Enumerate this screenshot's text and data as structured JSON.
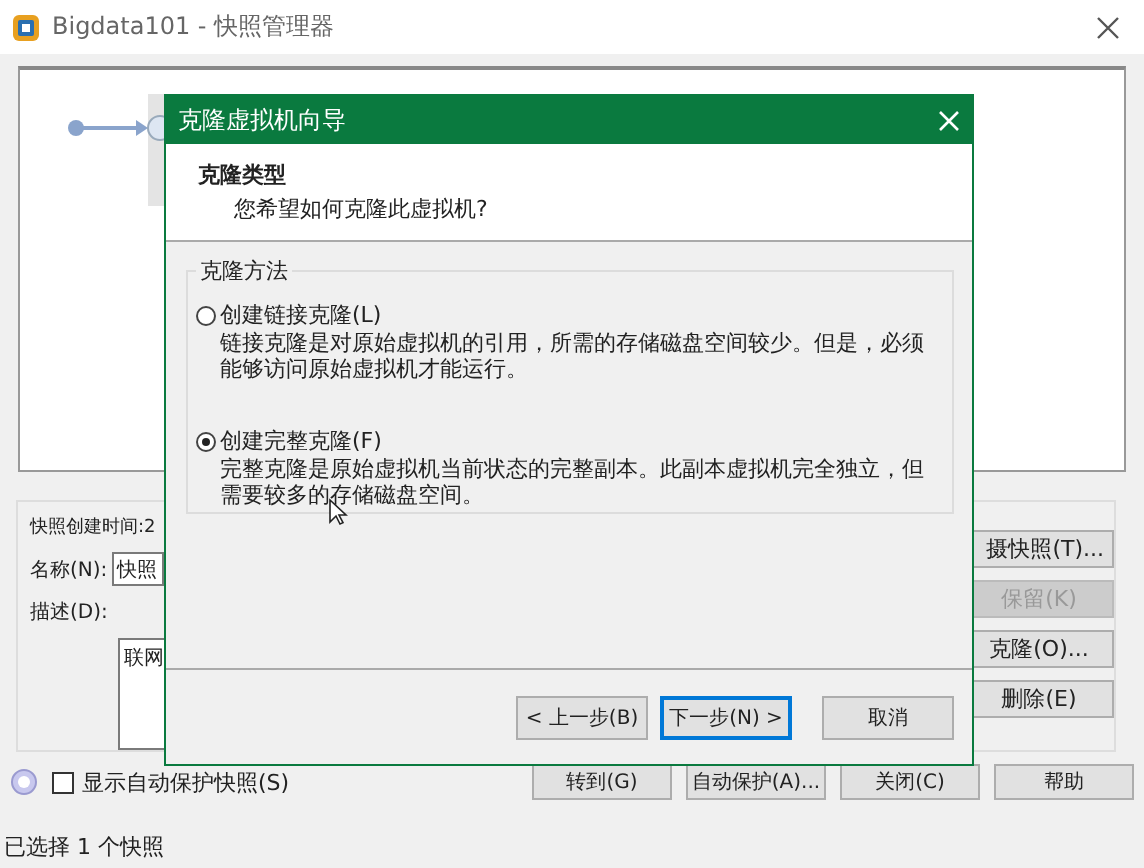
{
  "window": {
    "title": "Bigdata101 - 快照管理器"
  },
  "details": {
    "created_label": "快照创建时间:2",
    "name_label": "名称(N):",
    "name_value": "快照",
    "description_label": "描述(D):",
    "description_value": "联网"
  },
  "side_buttons": [
    {
      "label": "摄快照(T)...",
      "disabled": false
    },
    {
      "label": "保留(K)",
      "disabled": true
    },
    {
      "label": "克隆(O)...",
      "disabled": false
    },
    {
      "label": "删除(E)",
      "disabled": false
    }
  ],
  "show_autoprotect": {
    "label": "显示自动保护快照(S)",
    "checked": false
  },
  "bottom_buttons": [
    "转到(G)",
    "自动保护(A)...",
    "关闭(C)",
    "帮助"
  ],
  "status_bar": "已选择 1 个快照",
  "dialog": {
    "title": "克隆虚拟机向导",
    "heading": "克隆类型",
    "subheading": "您希望如何克隆此虚拟机?",
    "group_label": "克隆方法",
    "options": [
      {
        "label": "创建链接克隆(L)",
        "description": "链接克隆是对原始虚拟机的引用，所需的存储磁盘空间较少。但是，必须能够访问原始虚拟机才能运行。",
        "selected": false
      },
      {
        "label": "创建完整克隆(F)",
        "description": "完整克隆是原始虚拟机当前状态的完整副本。此副本虚拟机完全独立，但需要较多的存储磁盘空间。",
        "selected": true
      }
    ],
    "buttons": [
      {
        "label": "< 上一步(B)",
        "focused": false
      },
      {
        "label": "下一步(N) >",
        "focused": true
      },
      {
        "label": "取消",
        "focused": false
      }
    ]
  }
}
